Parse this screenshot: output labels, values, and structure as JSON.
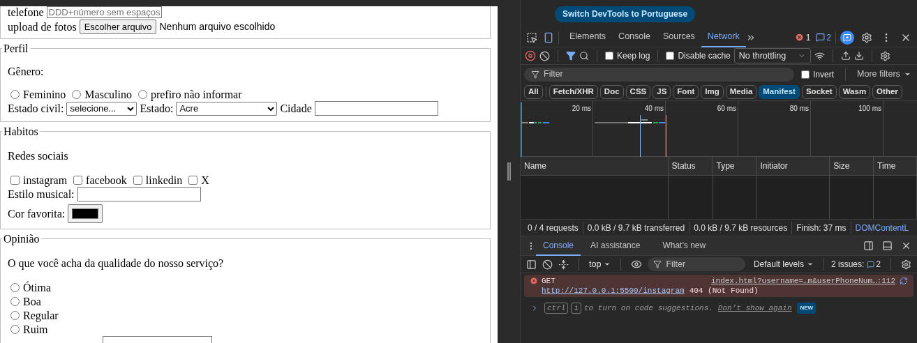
{
  "page": {
    "phone": {
      "label": "telefone",
      "placeholder": "DDD+número sem espaços"
    },
    "upload": {
      "label": "upload de fotos",
      "button": "Escolher arquivo",
      "status": "Nenhum arquivo escolhido"
    },
    "perfil": {
      "legend": "Perfil",
      "gender_label": "Gênero:",
      "gender_options": [
        {
          "label": "Feminino",
          "selected": false
        },
        {
          "label": "Masculino",
          "selected": false
        },
        {
          "label": "prefiro não informar",
          "selected": false
        }
      ],
      "civil_label": "Estado civil:",
      "civil_value": "selecione...",
      "state_label": "Estado:",
      "state_value": "Acre",
      "city_label": "Cidade"
    },
    "habitos": {
      "legend": "Habitos",
      "social_label": "Redes sociais",
      "social_options": [
        {
          "label": "instagram",
          "checked": false
        },
        {
          "label": "facebook",
          "checked": false
        },
        {
          "label": "linkedin",
          "checked": false
        },
        {
          "label": "X",
          "checked": false
        }
      ],
      "music_label": "Estilo musical:",
      "color_label": "Cor favorita:",
      "color": "#000000"
    },
    "opiniao": {
      "legend": "Opinião",
      "question": "O que você acha da qualidade do nosso serviço?",
      "options": [
        {
          "label": "Ótima",
          "selected": false
        },
        {
          "label": "Boa",
          "selected": false
        },
        {
          "label": "Regular",
          "selected": false
        },
        {
          "label": "Ruim",
          "selected": false
        }
      ]
    }
  },
  "devtools": {
    "banner": "Switch DevTools to Portuguese",
    "tabs": [
      {
        "label": "Elements",
        "selected": false
      },
      {
        "label": "Console",
        "selected": false
      },
      {
        "label": "Sources",
        "selected": false
      },
      {
        "label": "Network",
        "selected": true
      }
    ],
    "error_count": "1",
    "issue_count": "2",
    "keep_log": {
      "label": "Keep log",
      "checked": false
    },
    "disable_cache": {
      "label": "Disable cache",
      "checked": false
    },
    "throttling": "No throttling",
    "filter_placeholder": "Filter",
    "invert": {
      "label": "Invert",
      "checked": false
    },
    "more_filters": "More filters",
    "type_filters": [
      {
        "label": "All",
        "selected": false
      },
      {
        "label": "Fetch/XHR",
        "selected": false
      },
      {
        "label": "Doc",
        "selected": false
      },
      {
        "label": "CSS",
        "selected": false
      },
      {
        "label": "JS",
        "selected": false
      },
      {
        "label": "Font",
        "selected": false
      },
      {
        "label": "Img",
        "selected": false
      },
      {
        "label": "Media",
        "selected": false
      },
      {
        "label": "Manifest",
        "selected": true
      },
      {
        "label": "Socket",
        "selected": false
      },
      {
        "label": "Wasm",
        "selected": false
      },
      {
        "label": "Other",
        "selected": false
      }
    ],
    "timeline_ticks": [
      "20 ms",
      "40 ms",
      "60 ms",
      "80 ms",
      "100 ms"
    ],
    "columns": [
      "Name",
      "Status",
      "Type",
      "Initiator",
      "Size",
      "Time"
    ],
    "summary": [
      "0 / 4 requests",
      "0.0 kB / 9.7 kB transferred",
      "0.0 kB / 9.7 kB resources",
      "Finish: 37 ms"
    ],
    "summary_link": "DOMContentL",
    "drawer_tabs": [
      {
        "label": "Console",
        "selected": true
      },
      {
        "label": "AI assistance",
        "selected": false
      },
      {
        "label": "What’s new",
        "selected": false
      }
    ],
    "context": "top",
    "console_filter_placeholder": "Filter",
    "levels": "Default levels",
    "issues_label": "2 issues:",
    "issues_badge": "2",
    "error": {
      "method": "GET",
      "source": "index.html?username=…m&userPhoneNum…:112",
      "url": "http://127.0.0.1:5500/instagram",
      "status": "404 (Not Found)"
    },
    "hint": {
      "keys": [
        "ctrl",
        "i"
      ],
      "text": "to turn on code suggestions.",
      "link": "Don’t show again",
      "badge": "NEW"
    }
  }
}
